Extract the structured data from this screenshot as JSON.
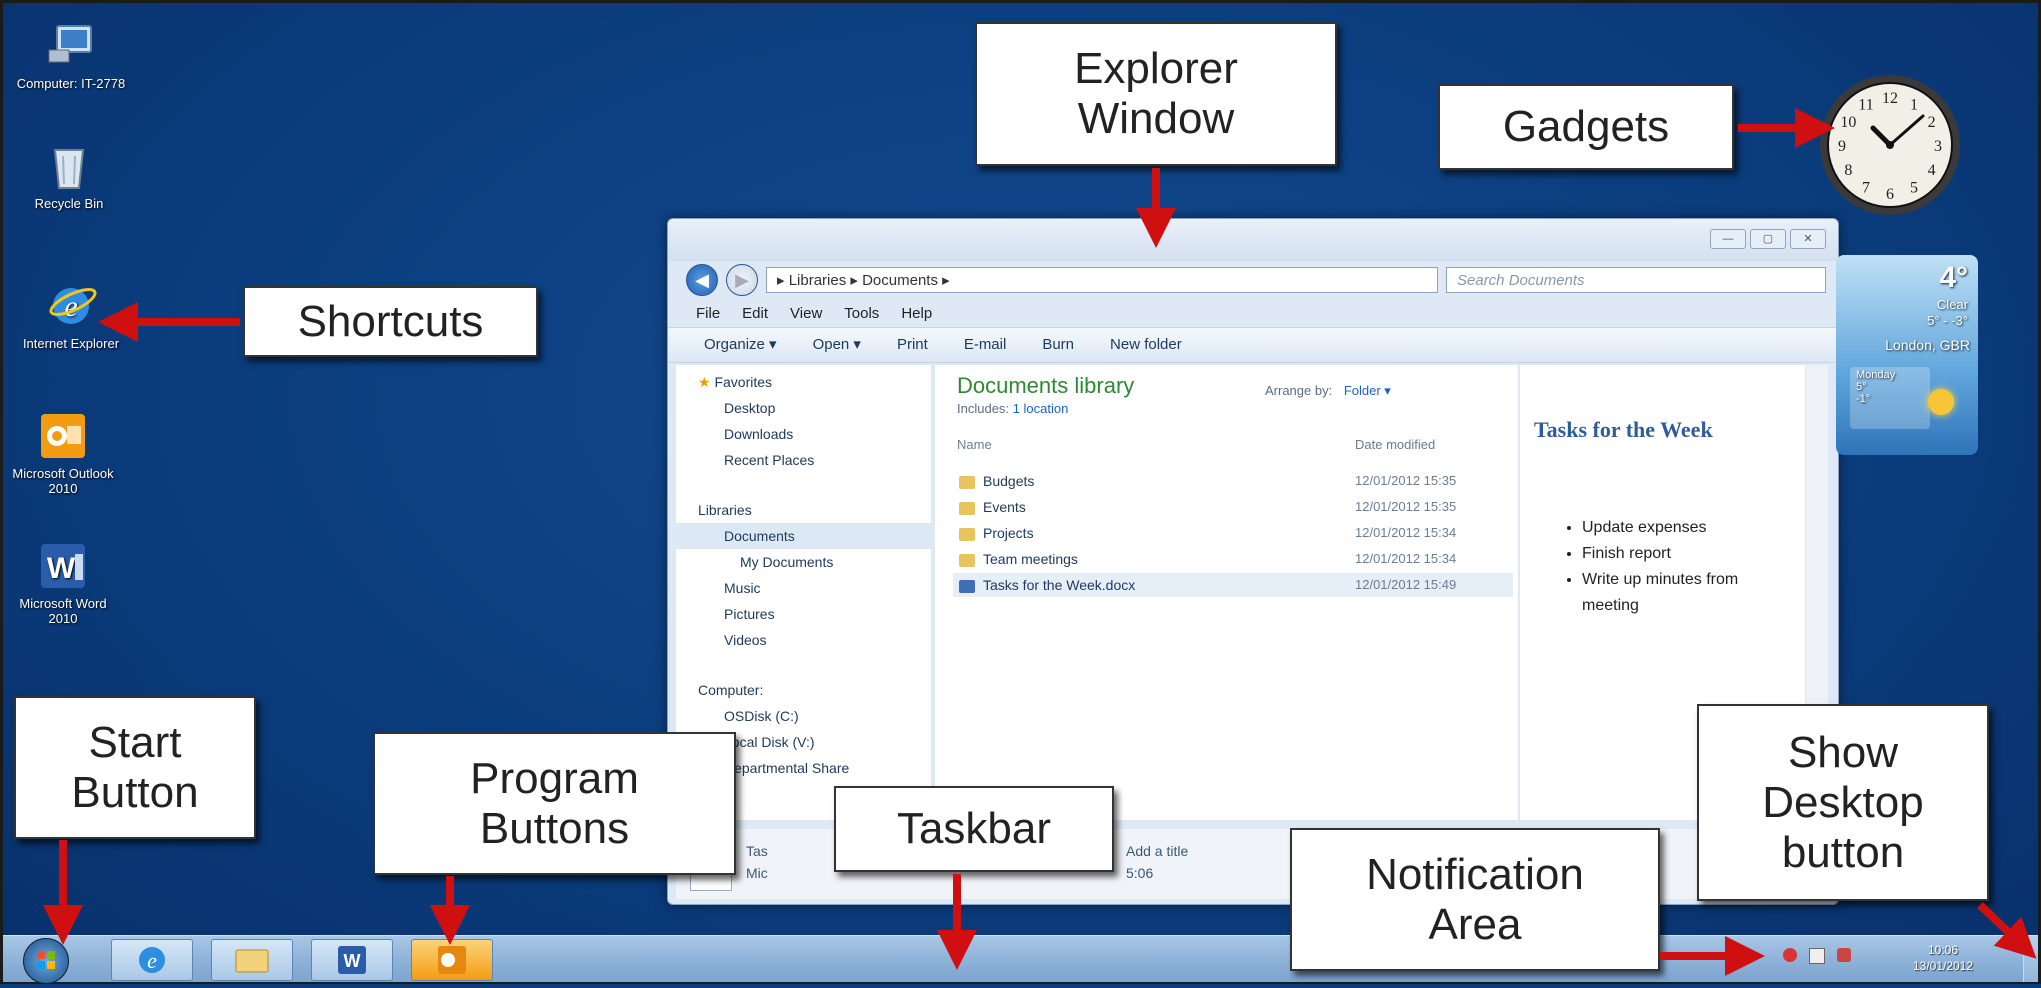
{
  "desktop": {
    "icons": [
      {
        "label": "Computer: IT-2778"
      },
      {
        "label": "Recycle Bin"
      },
      {
        "label": "Internet Explorer"
      },
      {
        "label": "Microsoft Outlook 2010"
      },
      {
        "label": "Microsoft Word 2010"
      }
    ]
  },
  "callouts": {
    "explorer_window": "Explorer Window",
    "gadgets": "Gadgets",
    "shortcuts": "Shortcuts",
    "start_button": "Start Button",
    "program_buttons": "Program Buttons",
    "taskbar": "Taskbar",
    "notification_area": "Notification Area",
    "show_desktop": "Show Desktop button"
  },
  "explorer": {
    "address": "▸ Libraries ▸ Documents ▸",
    "search_placeholder": "Search Documents",
    "menu": [
      "File",
      "Edit",
      "View",
      "Tools",
      "Help"
    ],
    "commands": [
      "Organize ▾",
      "Open ▾",
      "Print",
      "E-mail",
      "Burn",
      "New folder"
    ],
    "nav": {
      "favorites": "Favorites",
      "favorites_items": [
        "Desktop",
        "Downloads",
        "Recent Places"
      ],
      "libraries": "Libraries",
      "libraries_items": [
        "Documents",
        "My Documents",
        "Music",
        "Pictures",
        "Videos"
      ],
      "computer": "Computer:",
      "drives": [
        "OSDisk (C:)",
        "Local Disk (V:)",
        "Departmental Share"
      ]
    },
    "library_title": "Documents library",
    "includes_label": "Includes:",
    "includes_value": "1 location",
    "arrange_label": "Arrange by:",
    "arrange_value": "Folder ▾",
    "columns": {
      "name": "Name",
      "date": "Date modified"
    },
    "files": [
      {
        "name": "Budgets",
        "date": "12/01/2012 15:35"
      },
      {
        "name": "Events",
        "date": "12/01/2012 15:35"
      },
      {
        "name": "Projects",
        "date": "12/01/2012 15:34"
      },
      {
        "name": "Team meetings",
        "date": "12/01/2012 15:34"
      },
      {
        "name": "Tasks for the Week.docx",
        "date": "12/01/2012 15:49"
      }
    ],
    "preview": {
      "title": "Tasks for the Week",
      "bullets": [
        "Update expenses",
        "Finish report",
        "Write up minutes from meeting"
      ]
    },
    "details": {
      "name": "Tas",
      "type": "Mic",
      "title_prompt": "Add a title",
      "date": "5:06"
    }
  },
  "weather": {
    "temp": "4°",
    "condition": "Clear",
    "range": "5° - -3°",
    "location": "London, GBR",
    "day": "Monday",
    "hi": "5°",
    "lo": "-1°"
  },
  "clock": {
    "numerals": [
      "12",
      "1",
      "2",
      "3",
      "4",
      "5",
      "6",
      "7",
      "8",
      "9",
      "10",
      "11"
    ]
  },
  "tray": {
    "time": "10:06",
    "date": "13/01/2012"
  },
  "colors": {
    "arrow": "#d01010",
    "desktop": "#0b3d7e"
  }
}
